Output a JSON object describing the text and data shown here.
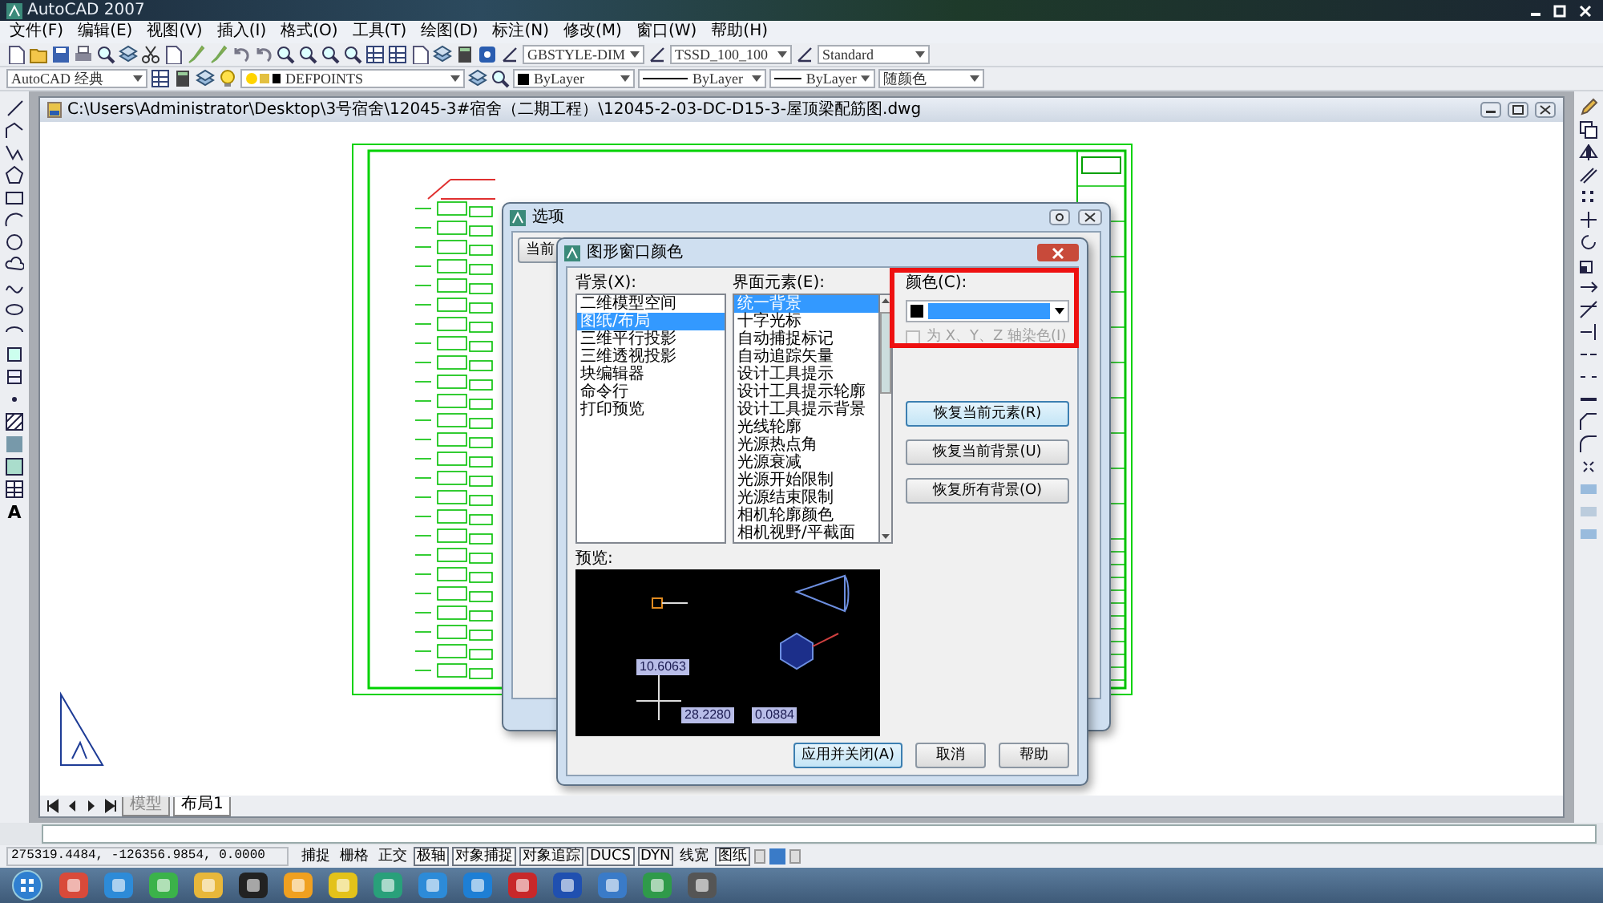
{
  "app": {
    "title": "AutoCAD 2007"
  },
  "menu": [
    "文件(F)",
    "编辑(E)",
    "视图(V)",
    "插入(I)",
    "格式(O)",
    "工具(T)",
    "绘图(D)",
    "标注(N)",
    "修改(M)",
    "窗口(W)",
    "帮助(H)"
  ],
  "style_combos": [
    "GBSTYLE-DIM",
    "TSSD_100_100",
    "Standard"
  ],
  "properties_bar": {
    "workspace": "AutoCAD 经典",
    "layer": "DEFPOINTS",
    "color_setting": "ByLayer",
    "linetype": "ByLayer",
    "lineweight": "ByLayer",
    "plot_style": "随颜色"
  },
  "draw_toolbar": {
    "text_tool": "A"
  },
  "document": {
    "path": "C:\\Users\\Administrator\\Desktop\\3号宿舍\\12045-3#宿舍（二期工程）\\12045-2-03-DC-D15-3-屋顶梁配筋图.dwg"
  },
  "layout_tabs": [
    {
      "label": "模型",
      "selected": false
    },
    {
      "label": "布局1",
      "selected": true
    }
  ],
  "options_dialog": {
    "title": "选项",
    "tab": "当前"
  },
  "color_dialog": {
    "title": "图形窗口颜色",
    "context_label": "背景(X):",
    "contexts": [
      {
        "label": "二维模型空间",
        "selected": false
      },
      {
        "label": "图纸/布局",
        "selected": true
      },
      {
        "label": "三维平行投影",
        "selected": false
      },
      {
        "label": "三维透视投影",
        "selected": false
      },
      {
        "label": "块编辑器",
        "selected": false
      },
      {
        "label": "命令行",
        "selected": false
      },
      {
        "label": "打印预览",
        "selected": false
      }
    ],
    "elements_label": "界面元素(E):",
    "elements": [
      {
        "label": "统一背景",
        "selected": true
      },
      {
        "label": "十字光标",
        "selected": false
      },
      {
        "label": "自动捕捉标记",
        "selected": false
      },
      {
        "label": "自动追踪矢量",
        "selected": false
      },
      {
        "label": "设计工具提示",
        "selected": false
      },
      {
        "label": "设计工具提示轮廓",
        "selected": false
      },
      {
        "label": "设计工具提示背景",
        "selected": false
      },
      {
        "label": "光线轮廓",
        "selected": false
      },
      {
        "label": "光源热点角",
        "selected": false
      },
      {
        "label": "光源衰减",
        "selected": false
      },
      {
        "label": "光源开始限制",
        "selected": false
      },
      {
        "label": "光源结束限制",
        "selected": false
      },
      {
        "label": "相机轮廓颜色",
        "selected": false
      },
      {
        "label": "相机视野/平截面",
        "selected": false
      }
    ],
    "color_label": "颜色(C):",
    "tint_checkbox": {
      "label": "为 X、Y、Z 轴染色(I)",
      "checked": false,
      "disabled": true
    },
    "restore_buttons": [
      "恢复当前元素(R)",
      "恢复当前背景(U)",
      "恢复所有背景(O)"
    ],
    "preview_label": "预览:",
    "preview_readouts": [
      "10.6063",
      "28.2280",
      "0.0884"
    ],
    "buttons": [
      "应用并关闭(A)",
      "取消",
      "帮助"
    ]
  },
  "status_bar": {
    "coordinates": "275319.4484, -126356.9854, 0.0000",
    "toggles": [
      {
        "label": "捕捉",
        "on": false
      },
      {
        "label": "栅格",
        "on": false
      },
      {
        "label": "正交",
        "on": false
      },
      {
        "label": "极轴",
        "on": true
      },
      {
        "label": "对象捕捉",
        "on": true
      },
      {
        "label": "对象追踪",
        "on": true
      },
      {
        "label": "DUCS",
        "on": true
      },
      {
        "label": "DYN",
        "on": true
      },
      {
        "label": "线宽",
        "on": false
      },
      {
        "label": "图纸",
        "on": true
      }
    ]
  }
}
